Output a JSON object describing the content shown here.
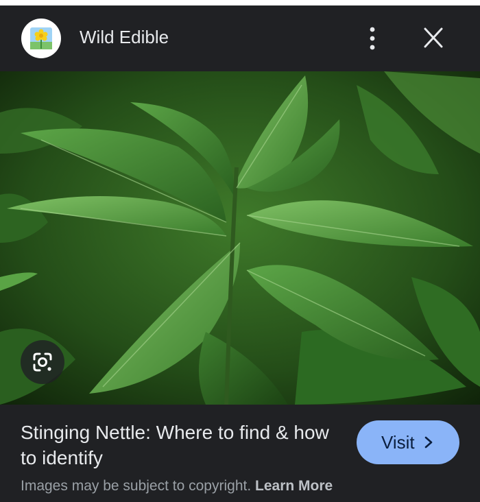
{
  "header": {
    "site_name": "Wild Edible",
    "logo_icon": "dandelion-flower-icon",
    "menu_icon": "more-vert-icon",
    "close_icon": "close-icon"
  },
  "image": {
    "subject": "stinging-nettle-plant-photo",
    "lens_icon": "google-lens-icon"
  },
  "caption": {
    "title": "Stinging Nettle: Where to find & how to identify",
    "visit_label": "Visit",
    "visit_icon": "chevron-right-icon",
    "copyright_text": "Images may be subject to copyright.",
    "learn_more": "Learn More"
  },
  "colors": {
    "background": "#202124",
    "visit_button": "#8ab4f8",
    "text_primary": "#e8eaed",
    "text_secondary": "#9aa0a6"
  }
}
